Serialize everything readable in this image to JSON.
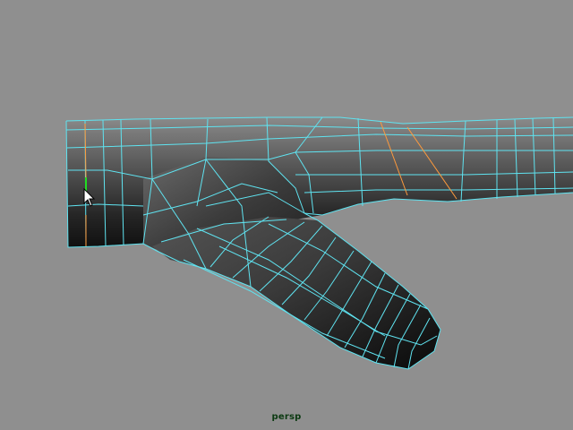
{
  "viewport": {
    "camera_name": "persp",
    "background_color": "#8f8f8f",
    "wire_color": "#5fe3f0",
    "selected_edge_color": "#ff9a3c",
    "axis_indicator_color": "#22dd22"
  },
  "mesh": {
    "object": "polygon-hand-model",
    "selection_mode": "edge"
  }
}
